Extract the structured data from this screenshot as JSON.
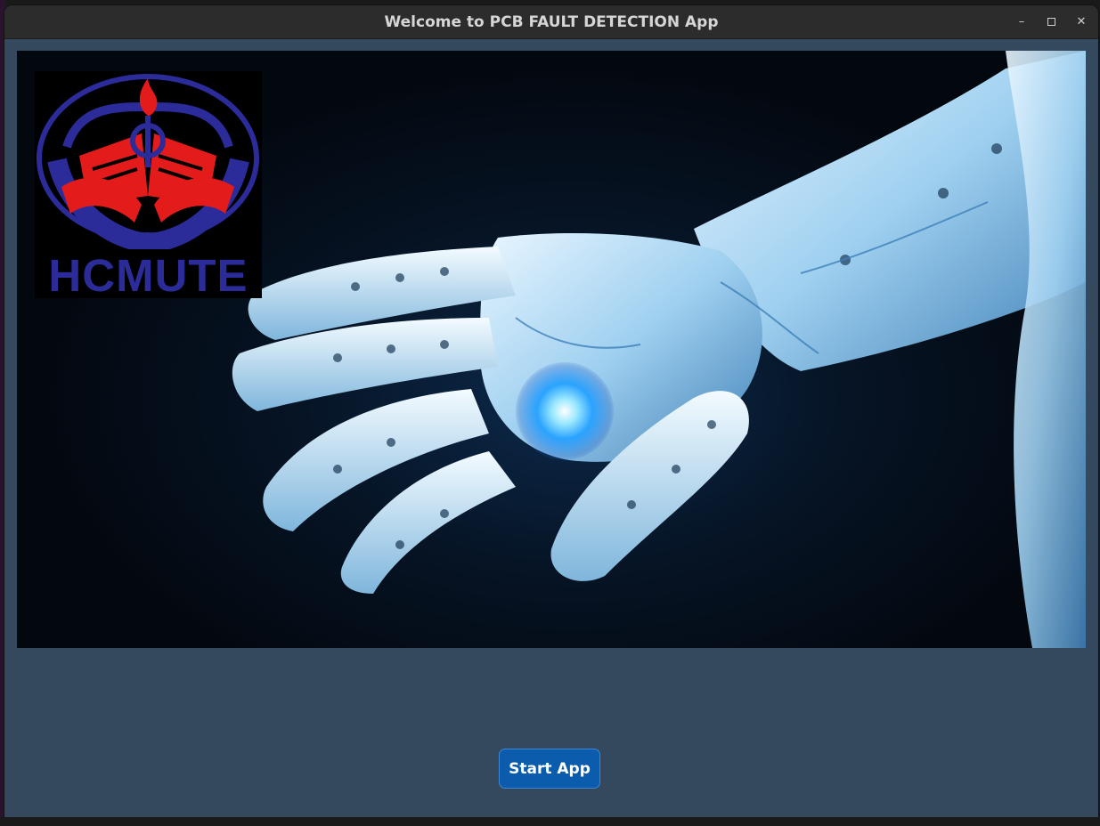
{
  "window": {
    "title": "Welcome to PCB FAULT DETECTION App",
    "controls": {
      "minimize": "–",
      "close": "✕"
    }
  },
  "hero": {
    "logo": {
      "text": "HCMUTE",
      "colors": {
        "ring": "#2b2c9a",
        "emblem": "#e31b1b",
        "flame": "#e31b1b"
      }
    },
    "image_description_icon": "robotic-hand-image",
    "accent": "#2aa3ff"
  },
  "actions": {
    "start_label": "Start App"
  },
  "colors": {
    "window_bg": "#34485e",
    "titlebar_bg": "#2c2c2c",
    "button_bg": "#0b5cad"
  }
}
